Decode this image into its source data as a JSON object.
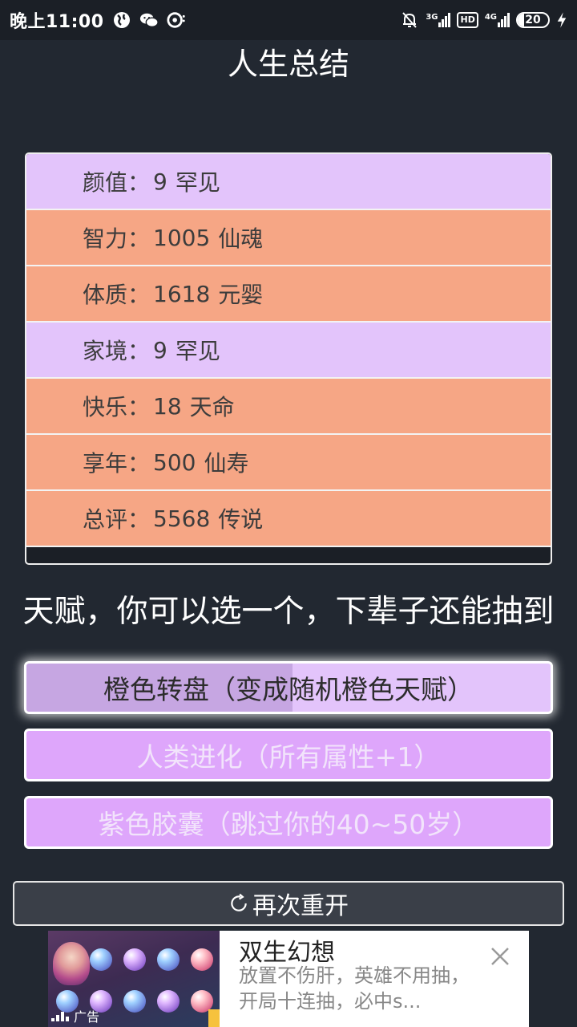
{
  "status_bar": {
    "time": "晚上11:00",
    "network_3g": "3G",
    "hd": "HD",
    "network_4g": "4G",
    "battery": "20",
    "icons": [
      "globe-icon",
      "wechat-icon",
      "music-icon",
      "mute-bell-icon",
      "signal-icon",
      "charging-icon"
    ]
  },
  "page": {
    "title": "人生总结"
  },
  "summary": {
    "rows": [
      {
        "label": "颜值",
        "value": "9",
        "grade": "罕见",
        "color": "#e3c4fb"
      },
      {
        "label": "智力",
        "value": "1005",
        "grade": "仙魂",
        "color": "#f6a685"
      },
      {
        "label": "体质",
        "value": "1618",
        "grade": "元婴",
        "color": "#f6a685"
      },
      {
        "label": "家境",
        "value": "9",
        "grade": "罕见",
        "color": "#e3c4fb"
      },
      {
        "label": "快乐",
        "value": "18",
        "grade": "天命",
        "color": "#f6a685"
      },
      {
        "label": "享年",
        "value": "500",
        "grade": "仙寿",
        "color": "#f6a685"
      },
      {
        "label": "总评",
        "value": "5568",
        "grade": "传说",
        "color": "#f6a685"
      }
    ]
  },
  "talents": {
    "heading": "天赋，你可以选一个，下辈子还能抽到",
    "items": [
      {
        "label": "橙色转盘（变成随机橙色天赋）",
        "selected": true
      },
      {
        "label": "人类进化（所有属性+1）",
        "selected": false
      },
      {
        "label": "紫色胶囊（跳过你的40~50岁）",
        "selected": false
      }
    ]
  },
  "restart": {
    "label": "再次重开",
    "icon": "refresh-icon"
  },
  "ad": {
    "title": "双生幻想",
    "description": "放置不伤肝，英雄不用抽，开局十连抽，必中s...",
    "tag": "广告",
    "close_icon": "close-icon"
  }
}
